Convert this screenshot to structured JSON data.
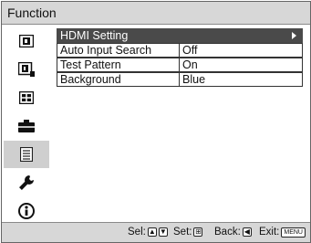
{
  "window": {
    "title": "Function"
  },
  "sidebar": {
    "items": [
      {
        "icon": "picture-icon",
        "active": false
      },
      {
        "icon": "picture-adjust-icon",
        "active": false
      },
      {
        "icon": "screen-icon",
        "active": false
      },
      {
        "icon": "setup-icon",
        "active": false
      },
      {
        "icon": "function-icon",
        "active": true
      },
      {
        "icon": "wrench-icon",
        "active": false
      },
      {
        "icon": "info-icon",
        "active": false
      }
    ]
  },
  "menu": {
    "items": [
      {
        "label": "HDMI Setting",
        "value": "",
        "selected": true,
        "has_submenu": true
      },
      {
        "label": "Auto Input Search",
        "value": "Off",
        "selected": false
      },
      {
        "label": "Test Pattern",
        "value": "On",
        "selected": false
      },
      {
        "label": "Background",
        "value": "Blue",
        "selected": false
      }
    ]
  },
  "statusbar": {
    "sel_label": "Sel:",
    "set_label": "Set:",
    "back_label": "Back:",
    "exit_label": "Exit:",
    "exit_key": "MENU"
  }
}
